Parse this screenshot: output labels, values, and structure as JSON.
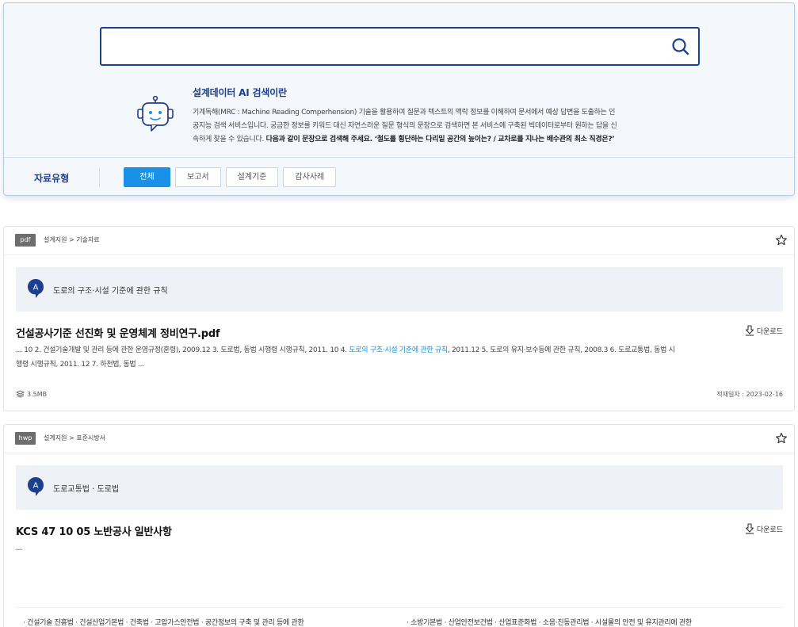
{
  "search": {
    "placeholder": "",
    "value": ""
  },
  "ai_info": {
    "title": "설계데이터 AI 검색이란",
    "desc_line1": "기계독해(MRC : Machine Reading Comperhension) 기술을 활용하여 질문과 텍스트의 맥락 정보를 이해하여 문서에서 예상 답변을 도출하는 인",
    "desc_line2": "공지능 검색 서비스입니다. 궁금한 정보를 키워드 대신 자연스러운 질문 형식의 문장으로 검색하면 본 서비스에 구축된 빅데이터로부터 원하는 답을 신",
    "desc_line3": "속하게 찾을 수 있습니다. ",
    "desc_bold": "다음과 같이 문장으로 검색해 주세요. ‘철도를 횡단하는 다리밑 공간의 높이는? / 교차로를 지나는 배수관의 최소 직경은?’"
  },
  "filter": {
    "label": "자료유형",
    "tabs": [
      "전체",
      "보고서",
      "설계기준",
      "감사사례"
    ],
    "active": 0
  },
  "results": [
    {
      "badge": "pdf",
      "breadcrumb": "설계지원 > 기술자료",
      "answer_icon": "A",
      "answer": "도로의 구조·시설 기준에 관한 규칙",
      "title": "건설공사기준 선진화 및 운영체계 정비연구.pdf",
      "download_label": "다운로드",
      "snippet_pre": "... 10 2. 건설기술개발 및 관리 등에 관한 운영규정(훈령), 2009.12 3. 도로법, 동법 시행령 시행규칙, 2011. 10 4. ",
      "snippet_hl": "도로의 구조·시설 기준에 관한 규칙",
      "snippet_post": ", 2011.12 5. 도로의 유지·보수등에 관한 규칙, 2008.3 6. 도로교통법, 동법 시",
      "snippet_line2": "행령 시행규칙, 2011. 12 7. 하천법, 동법 ...",
      "size": "3.5MB",
      "date": "적재일자 : 2023-02-16"
    },
    {
      "badge": "hwp",
      "breadcrumb": "설계지원 > 표준시방서",
      "answer_icon": "A",
      "answer": "도로교통법 · 도로법",
      "title": "KCS 47 10 05 노반공사 일반사항",
      "download_label": "다운로드",
      "snippet": "...",
      "laws_left": "· 건설기술 진흥법 · 건설산업기본법 · 건축법 · 고압가스안전법 · 공간정보의 구축 및 관리 등에 관한",
      "laws_right": "· 소방기본법 · 산업안전보건법 · 산업표준화법 · 소음·진동관리법 · 시설물의 안전 및 유지관리에 관한"
    }
  ],
  "colors": {
    "brand": "#1c3f8e",
    "accent": "#1991e6",
    "highlight": "#1a8fd6"
  }
}
